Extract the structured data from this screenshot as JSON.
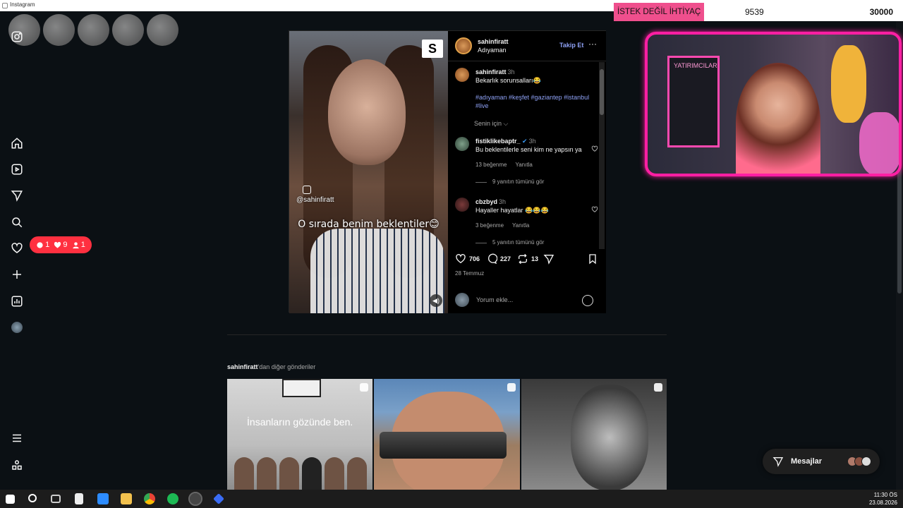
{
  "window": {
    "title": "Instagram"
  },
  "stream": {
    "goal_label": "İSTEK DEĞİL İHTİYAÇ",
    "goal_current": "9539",
    "goal_target": "30000",
    "cam_sign": "YATIRIMCILAR"
  },
  "sidebar": {
    "items": [
      "home",
      "reels",
      "direct",
      "search",
      "notifications",
      "create",
      "insights",
      "profile"
    ],
    "notifications_badge": {
      "comments": "1",
      "likes": "9",
      "follows": "1"
    }
  },
  "post": {
    "username": "sahinfiratt",
    "location": "Adıyaman",
    "follow_label": "Takip Et",
    "more_label": "···",
    "media_handle": "@sahinfiratt",
    "media_caption": "O sırada benim beklentiler😊",
    "caption": {
      "username": "sahinfiratt",
      "time": "3h",
      "text": "Bekarlık sorunsalları😂",
      "hashtags": "#adıyaman #keşfet #gaziantep #istanbul #live"
    },
    "sort_label": "Senin için",
    "comments": [
      {
        "username": "fistiklikebaptr_",
        "verified": true,
        "time": "3h",
        "text": "Bu beklentilerle seni kim ne yapsın ya",
        "likes": "13 beğenme",
        "reply": "Yanıtla",
        "view_replies": "9 yanıtın tümünü gör"
      },
      {
        "username": "cbzbyd",
        "verified": false,
        "time": "3h",
        "text": "Hayaller hayatlar 😂😂😂",
        "likes": "3 beğenme",
        "reply": "Yanıtla",
        "view_replies": "5 yanıtın tümünü gör"
      }
    ],
    "likes": "706",
    "comment_count": "227",
    "reposts": "13",
    "date": "28 Temmuz",
    "add_comment_placeholder": "Yorum ekle..."
  },
  "more_posts": {
    "username": "sahinfiratt",
    "suffix": "'dan diğer gönderiler",
    "tiles": [
      {
        "text": "İnsanların gözünde ben."
      },
      {
        "text": ""
      },
      {
        "text": ""
      }
    ]
  },
  "messages": {
    "label": "Mesajlar"
  },
  "taskbar": {
    "time": "11:30 ÖS",
    "date": "23.08.2026"
  },
  "colors": {
    "accent_link": "#8ea1f5",
    "notif_red": "#ff3040",
    "cam_border": "#ff1fa3",
    "goal_pink": "#ef4f8d"
  }
}
